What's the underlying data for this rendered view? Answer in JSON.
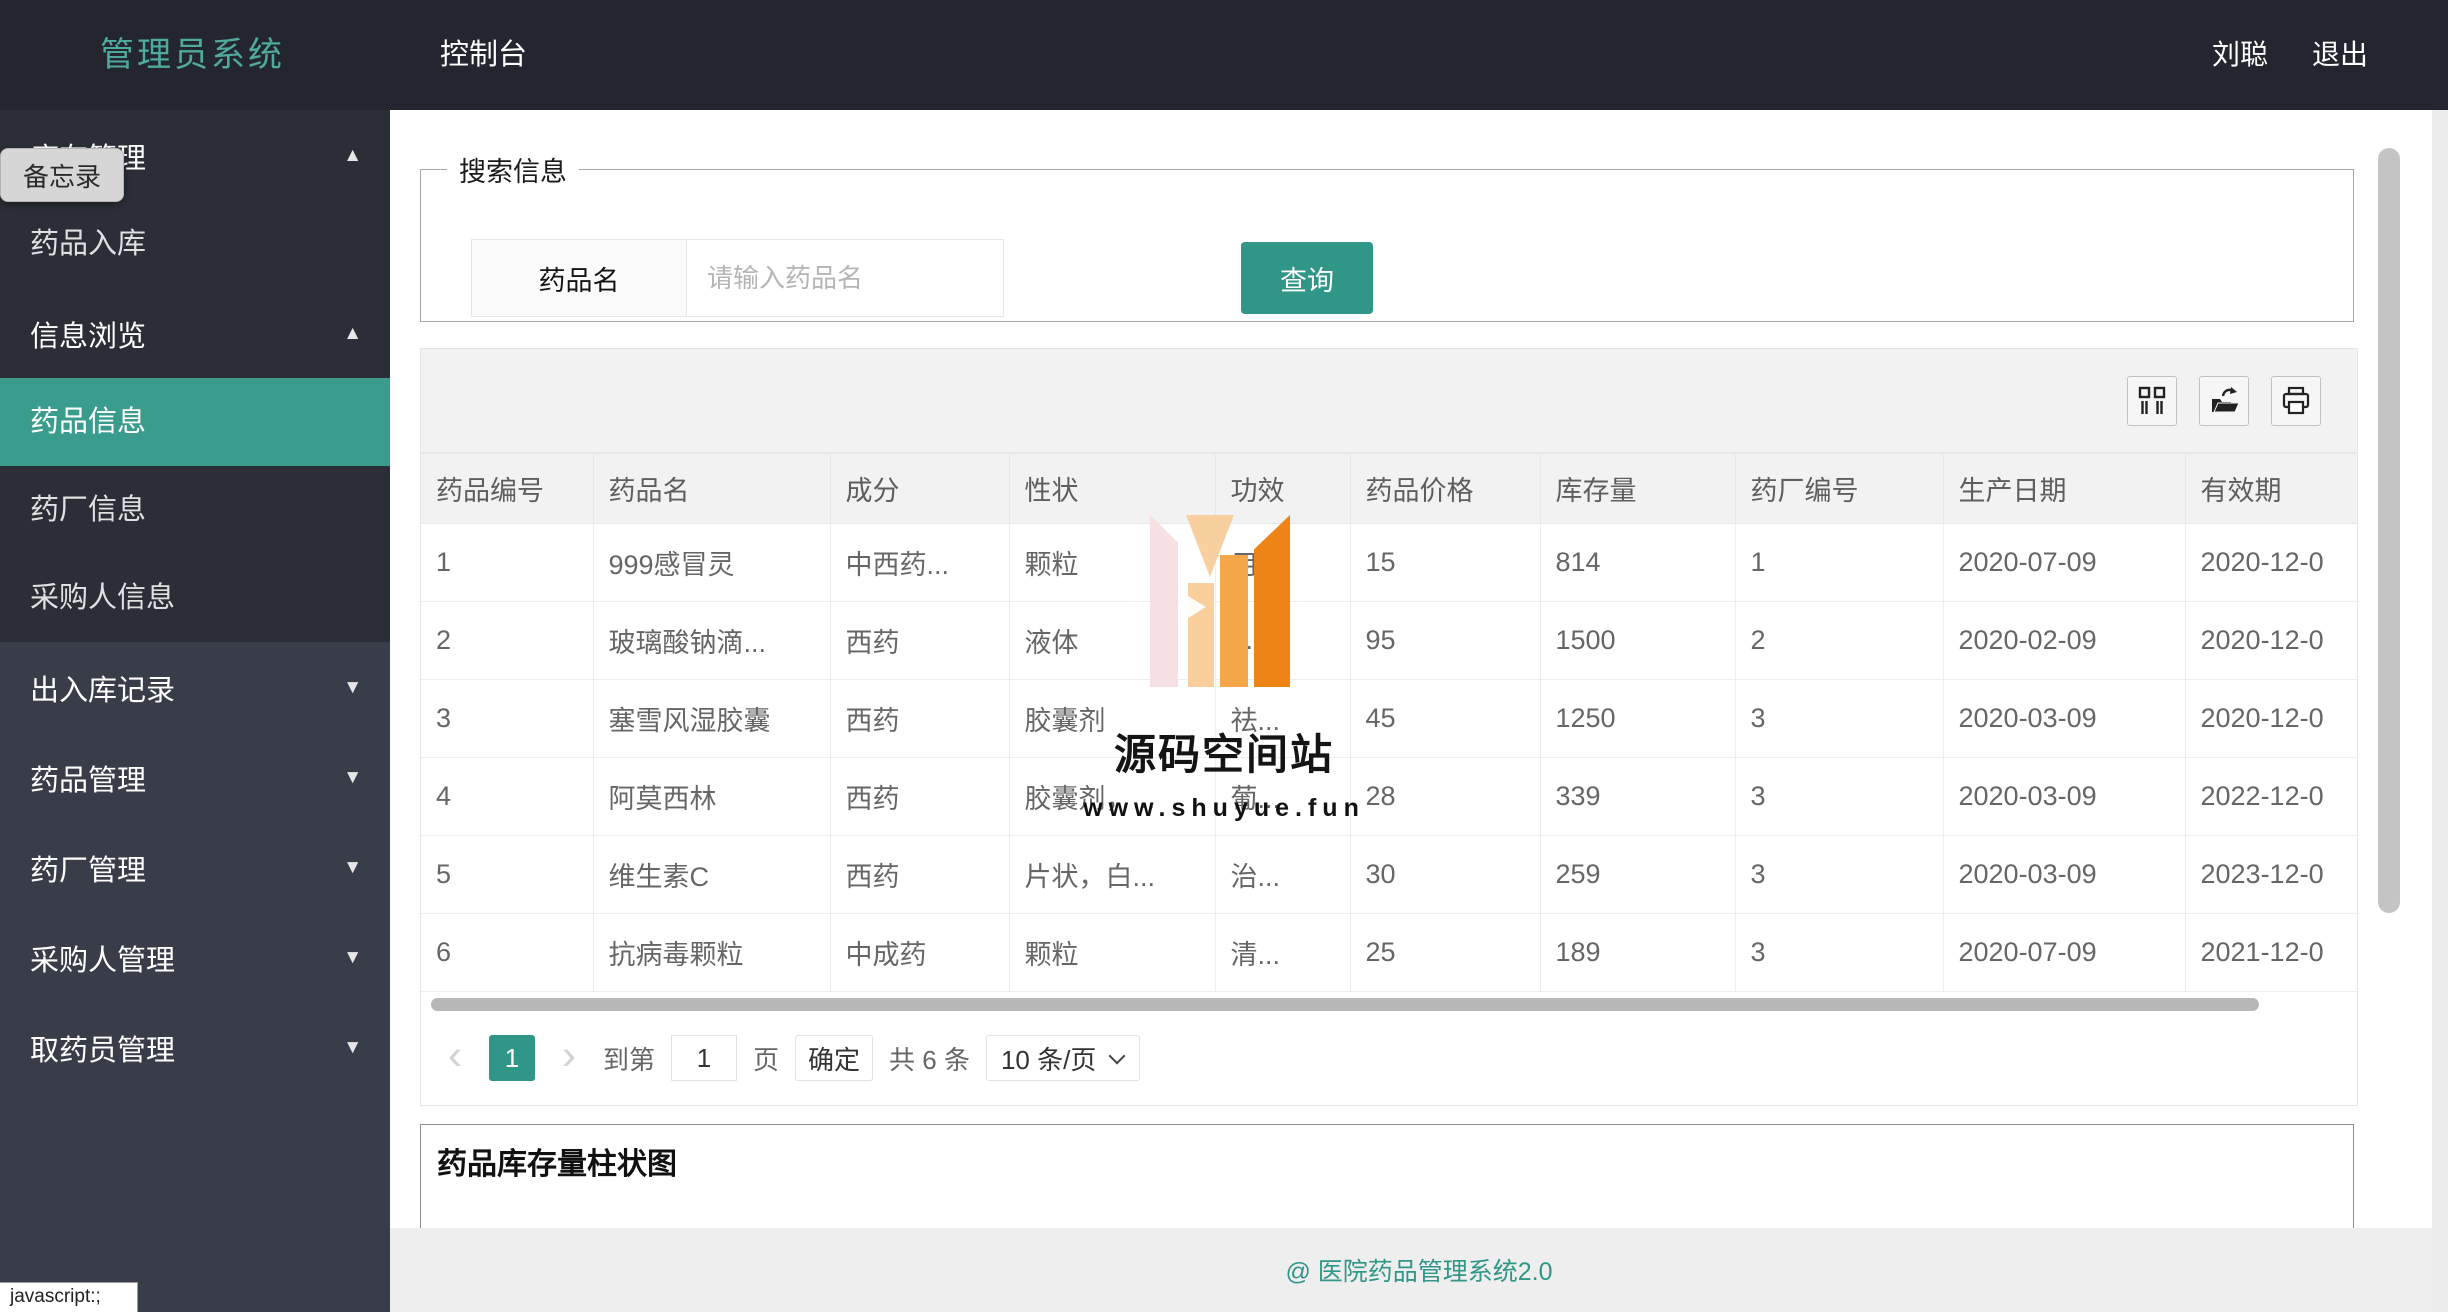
{
  "header": {
    "brand": "管理员系统",
    "console": "控制台",
    "username": "刘聪",
    "logout": "退出"
  },
  "sidebar": {
    "tooltip": "备忘录",
    "groups": [
      {
        "label": "库存管理",
        "state": "expanded",
        "items": [
          {
            "label": "药品入库",
            "active": false
          }
        ]
      },
      {
        "label": "信息浏览",
        "state": "expanded",
        "items": [
          {
            "label": "药品信息",
            "active": true
          },
          {
            "label": "药厂信息",
            "active": false
          },
          {
            "label": "采购人信息",
            "active": false
          }
        ]
      },
      {
        "label": "出入库记录",
        "state": "collapsed",
        "items": []
      },
      {
        "label": "药品管理",
        "state": "collapsed",
        "items": []
      },
      {
        "label": "药厂管理",
        "state": "collapsed",
        "items": []
      },
      {
        "label": "采购人管理",
        "state": "collapsed",
        "items": []
      },
      {
        "label": "取药员管理",
        "state": "collapsed",
        "items": []
      }
    ]
  },
  "search": {
    "legend": "搜索信息",
    "field_label": "药品名",
    "placeholder": "请输入药品名",
    "submit_label": "查询"
  },
  "toolbar": {
    "icons": [
      "columns-filter-icon",
      "export-icon",
      "print-icon"
    ]
  },
  "table": {
    "columns": [
      "药品编号",
      "药品名",
      "成分",
      "性状",
      "功效",
      "药品价格",
      "库存量",
      "药厂编号",
      "生产日期",
      "有效期"
    ],
    "rows": [
      [
        "1",
        "999感冒灵",
        "中西药...",
        "颗粒",
        "用...",
        "15",
        "814",
        "1",
        "2020-07-09",
        "2020-12-0"
      ],
      [
        "2",
        "玻璃酸钠滴...",
        "西药",
        "液体",
        "...",
        "95",
        "1500",
        "2",
        "2020-02-09",
        "2020-12-0"
      ],
      [
        "3",
        "塞雪风湿胶囊",
        "西药",
        "胶囊剂",
        "祛...",
        "45",
        "1250",
        "3",
        "2020-03-09",
        "2020-12-0"
      ],
      [
        "4",
        "阿莫西林",
        "西药",
        "胶囊剂，...",
        "葡...",
        "28",
        "339",
        "3",
        "2020-03-09",
        "2022-12-0"
      ],
      [
        "5",
        "维生素C",
        "西药",
        "片状，白...",
        "治...",
        "30",
        "259",
        "3",
        "2020-03-09",
        "2023-12-0"
      ],
      [
        "6",
        "抗病毒颗粒",
        "中成药",
        "颗粒",
        "清...",
        "25",
        "189",
        "3",
        "2020-07-09",
        "2021-12-0"
      ]
    ]
  },
  "pagination": {
    "prev": "‹",
    "current_page": "1",
    "next": "›",
    "goto_prefix": "到第",
    "goto_value": "1",
    "goto_suffix": "页",
    "confirm_label": "确定",
    "total_label": "共 6 条",
    "page_size_label": "10 条/页"
  },
  "chart_panel": {
    "title": "药品库存量柱状图"
  },
  "watermark": {
    "title": "源码空间站",
    "url": "www.shuyue.fun"
  },
  "footer": {
    "text": "@ 医院药品管理系统2.0"
  },
  "statusbar": {
    "text": "javascript:;"
  },
  "colors": {
    "accent": "#2f9688",
    "sidebar_active": "#3a9c8c",
    "brand": "#4fa99d",
    "header_bg": "#23262e",
    "sidebar_bg": "#393d49"
  }
}
